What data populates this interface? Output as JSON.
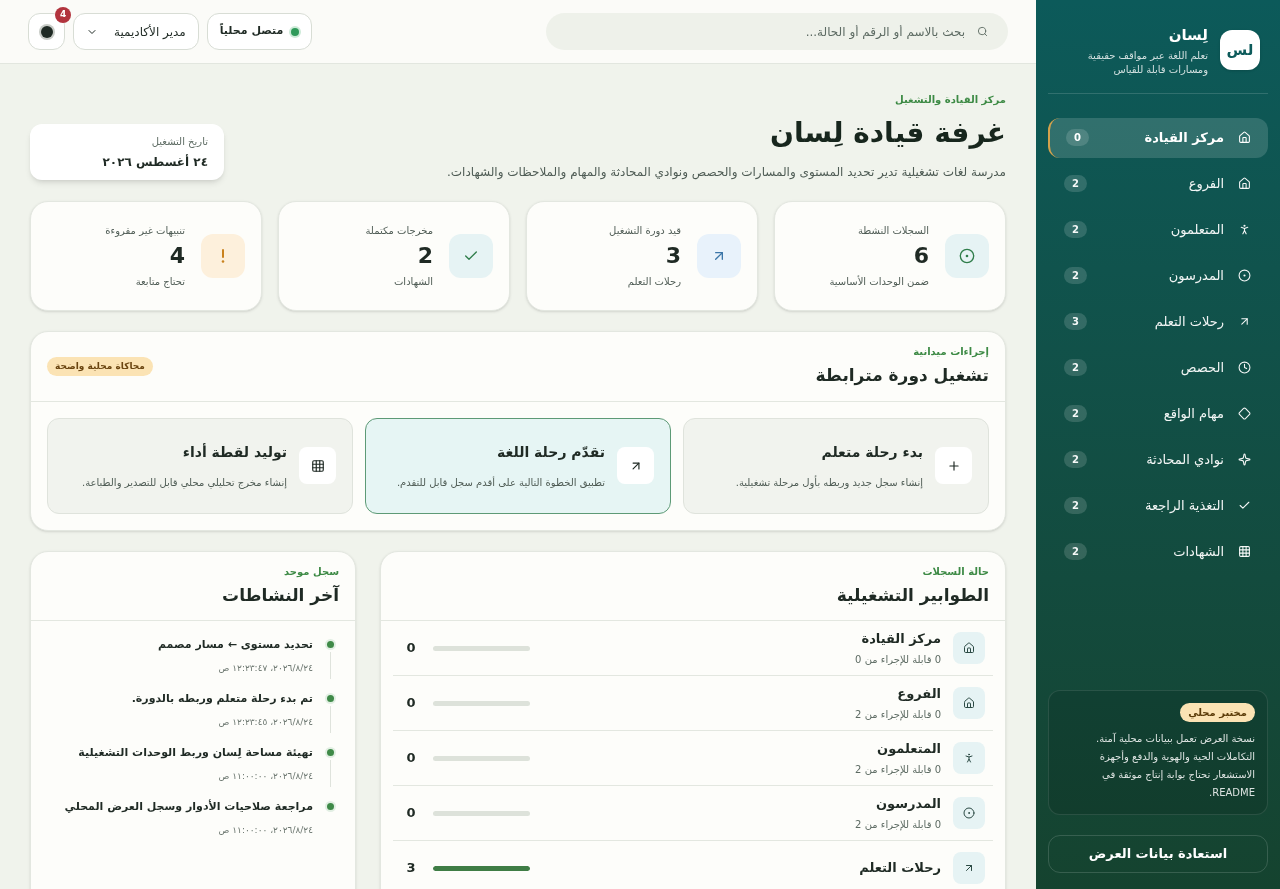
{
  "topbar": {
    "search": {
      "placeholder": "بحث بالاسم أو الرقم أو الحالة..."
    },
    "status": {
      "label": "متصل محلياً",
      "online": true
    },
    "role_select": {
      "value": "مدير الأكاديمية"
    },
    "notifications": {
      "count": "4"
    }
  },
  "header": {
    "eyebrow": "مركز القيادة والتشغيل",
    "title": "غرفة قيادة لِسان",
    "description": "مدرسة لغات تشغيلية تدير تحديد المستوى والمسارات والحصص ونوادي المحادثة والمهام والملاحظات والشهادات.",
    "date_card": {
      "label": "تاريخ التشغيل",
      "value": "٢٤ أغسطس ٢٠٢٦"
    }
  },
  "stats": [
    {
      "kind": "target",
      "label": "السجلات النشطة",
      "value": "6",
      "note": "ضمن الوحدات الأساسية"
    },
    {
      "kind": "arrow",
      "label": "قيد دورة التشغيل",
      "value": "3",
      "note": "رحلات التعلم"
    },
    {
      "kind": "check",
      "label": "مخرجات مكتملة",
      "value": "2",
      "note": "الشهادات"
    },
    {
      "kind": "alert",
      "label": "تنبيهات غير مقروءة",
      "value": "4",
      "note": "تحتاج متابعة"
    }
  ],
  "actions_panel": {
    "eyebrow": "إجراءات ميدانية",
    "title": "تشغيل دورة مترابطة",
    "badge": "محاكاة محلية واضحة",
    "actions": [
      {
        "kind": "add",
        "title": "بدء رحلة متعلم",
        "description": "إنشاء سجل جديد وربطه بأول مرحلة تشغيلية.",
        "selected": false
      },
      {
        "kind": "advance",
        "title": "تقدّم رحلة اللغة",
        "description": "تطبيق الخطوة التالية على أقدم سجل قابل للتقدم.",
        "selected": true
      },
      {
        "kind": "report",
        "title": "توليد لقطة أداء",
        "description": "إنشاء مخرج تحليلي محلي قابل للتصدير والطباعة.",
        "selected": false
      }
    ]
  },
  "queues_panel": {
    "eyebrow": "حالة السجلات",
    "title": "الطوابير التشغيلية",
    "rows": [
      {
        "kind": "house",
        "name": "مركز القيادة",
        "detail": "0 قابلة للإجراء من 0",
        "count": "0",
        "level": 0
      },
      {
        "kind": "house",
        "name": "الفروع",
        "detail": "0 قابلة للإجراء من 2",
        "count": "0",
        "level": 0
      },
      {
        "kind": "person",
        "name": "المتعلمون",
        "detail": "0 قابلة للإجراء من 2",
        "count": "0",
        "level": 0
      },
      {
        "kind": "target",
        "name": "المدرسون",
        "detail": "0 قابلة للإجراء من 2",
        "count": "0",
        "level": 0
      },
      {
        "kind": "arrow",
        "name": "رحلات التعلم",
        "count": "3",
        "level": 1
      }
    ]
  },
  "activity_panel": {
    "eyebrow": "سجل موحد",
    "title": "آخر النشاطات",
    "items": [
      {
        "title": "تحديد مستوى ← مسار مصمم",
        "time": "٢٠٢٦/٨/٢٤، ١٢:٢٣:٤٧ ص"
      },
      {
        "title": "تم بدء رحلة متعلم وربطه بالدورة.",
        "time": "٢٠٢٦/٨/٢٤، ١٢:٢٣:٤٥ ص"
      },
      {
        "title": "تهيئة مساحة لِسان وربط الوحدات التشغيلية",
        "time": "٢٠٢٦/٨/٢٤، ١١:٠٠:٠٠ ص"
      },
      {
        "title": "مراجعة صلاحيات الأدوار وسجل العرض المحلي",
        "time": "٢٠٢٦/٨/٢٤، ١١:٠٠:٠٠ ص"
      }
    ]
  },
  "sidebar": {
    "logo": "لس",
    "brand": "لِسان",
    "tagline": "تعلم اللغة عبر مواقف حقيقية ومسارات قابلة للقياس",
    "items": [
      {
        "kind": "house",
        "label": "مركز القيادة",
        "count": "0",
        "selected": true
      },
      {
        "kind": "house",
        "label": "الفروع",
        "count": "2",
        "selected": false
      },
      {
        "kind": "person",
        "label": "المتعلمون",
        "count": "2",
        "selected": false
      },
      {
        "kind": "target",
        "label": "المدرسون",
        "count": "2",
        "selected": false
      },
      {
        "kind": "arrow",
        "label": "رحلات التعلم",
        "count": "3",
        "selected": false
      },
      {
        "kind": "clock",
        "label": "الحصص",
        "count": "2",
        "selected": false
      },
      {
        "kind": "diamond",
        "label": "مهام الواقع",
        "count": "2",
        "selected": false
      },
      {
        "kind": "sparkle",
        "label": "نوادي المحادثة",
        "count": "2",
        "selected": false
      },
      {
        "kind": "check",
        "label": "التغذية الراجعة",
        "count": "2",
        "selected": false
      },
      {
        "kind": "grid",
        "label": "الشهادات",
        "count": "2",
        "selected": false
      }
    ],
    "lab_card": {
      "badge": "مختبر محلي",
      "text": "نسخة العرض تعمل ببيانات محلية آمنة. التكاملات الحية والهوية والدفع وأجهزة الاستشعار تحتاج بوابة إنتاج موثقة في README."
    },
    "restore_button": "استعادة بيانات العرض"
  }
}
